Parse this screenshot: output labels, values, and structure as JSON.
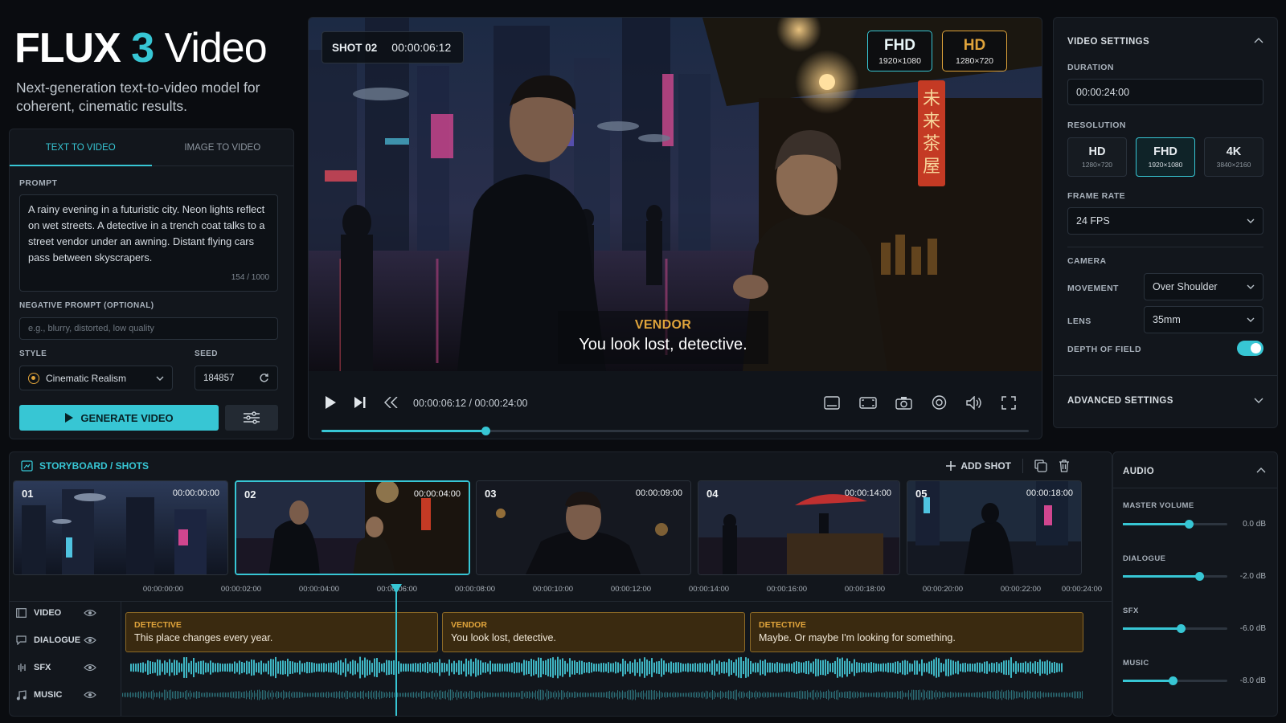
{
  "app": {
    "title_main": "FLUX",
    "title_num": "3",
    "title_sub": "Video",
    "tagline": "Next-generation text-to-video model for coherent, cinematic results."
  },
  "left": {
    "tabs": [
      {
        "label": "TEXT TO VIDEO",
        "active": true
      },
      {
        "label": "IMAGE TO VIDEO",
        "active": false
      }
    ],
    "prompt_label": "PROMPT",
    "prompt_text": "A rainy evening in a futuristic city. Neon lights reflect on wet streets. A detective in a trench coat talks to a street vendor under an awning. Distant flying cars pass between skyscrapers.",
    "prompt_count": "154 / 1000",
    "negative_label": "NEGATIVE PROMPT (OPTIONAL)",
    "negative_placeholder": "e.g., blurry, distorted, low quality",
    "style_label": "STYLE",
    "style_value": "Cinematic Realism",
    "seed_label": "SEED",
    "seed_value": "184857",
    "generate_label": "GENERATE VIDEO"
  },
  "preview": {
    "shot": "SHOT 02",
    "timecode": "00:00:06:12",
    "badges": [
      {
        "label": "FHD",
        "sub": "1920×1080",
        "color": "#37c6d4"
      },
      {
        "label": "HD",
        "sub": "1280×720",
        "color": "#e0a43b"
      }
    ],
    "subtitle_speaker": "VENDOR",
    "subtitle_line": "You look lost, detective.",
    "time_current": "00:00:06:12",
    "time_total": "00:00:24:00",
    "progress": 0.232
  },
  "settings": {
    "title": "VIDEO SETTINGS",
    "duration_label": "DURATION",
    "duration_value": "00:00:24:00",
    "resolution_label": "RESOLUTION",
    "resolutions": [
      {
        "label": "HD",
        "sub": "1280×720"
      },
      {
        "label": "FHD",
        "sub": "1920×1080"
      },
      {
        "label": "4K",
        "sub": "3840×2160"
      }
    ],
    "resolution_selected": "FHD",
    "framerate_label": "FRAME RATE",
    "framerate_value": "24 FPS",
    "camera_label": "CAMERA",
    "movement_label": "MOVEMENT",
    "movement_value": "Over Shoulder",
    "lens_label": "LENS",
    "lens_value": "35mm",
    "dof_label": "DEPTH OF FIELD",
    "dof_on": true,
    "advanced_label": "ADVANCED SETTINGS"
  },
  "storyboard": {
    "title": "STORYBOARD / SHOTS",
    "add_label": "ADD SHOT",
    "shots": [
      {
        "num": "01",
        "time": "00:00:00:00"
      },
      {
        "num": "02",
        "time": "00:00:04:00",
        "selected": true
      },
      {
        "num": "03",
        "time": "00:00:09:00"
      },
      {
        "num": "04",
        "time": "00:00:14:00"
      },
      {
        "num": "05",
        "time": "00:00:18:00"
      }
    ],
    "ruler": [
      "00:00:00:00",
      "00:00:02:00",
      "00:00:04:00",
      "00:00:06:00",
      "00:00:08:00",
      "00:00:10:00",
      "00:00:12:00",
      "00:00:14:00",
      "00:00:16:00",
      "00:00:18:00",
      "00:00:20:00",
      "00:00:22:00",
      "00:00:24:00"
    ],
    "tracks": [
      {
        "label": "VIDEO",
        "icon": "film-icon"
      },
      {
        "label": "DIALOGUE",
        "icon": "speech-bubble-icon"
      },
      {
        "label": "SFX",
        "icon": "waveform-icon"
      },
      {
        "label": "MUSIC",
        "icon": "music-note-icon"
      }
    ],
    "dialogue": [
      {
        "speaker": "DETECTIVE",
        "text": "This place changes every year."
      },
      {
        "speaker": "VENDOR",
        "text": "You look lost, detective."
      },
      {
        "speaker": "DETECTIVE",
        "text": "Maybe. Or maybe I'm looking for something."
      }
    ]
  },
  "audio": {
    "title": "AUDIO",
    "channels": [
      {
        "label": "MASTER VOLUME",
        "value": "0.0 dB",
        "level": 0.63
      },
      {
        "label": "DIALOGUE",
        "value": "-2.0 dB",
        "level": 0.73
      },
      {
        "label": "SFX",
        "value": "-6.0 dB",
        "level": 0.55
      },
      {
        "label": "MUSIC",
        "value": "-8.0 dB",
        "level": 0.48
      }
    ]
  },
  "colors": {
    "accent": "#37c6d4",
    "amber": "#e0a43b",
    "bg": "#0a0c10"
  }
}
